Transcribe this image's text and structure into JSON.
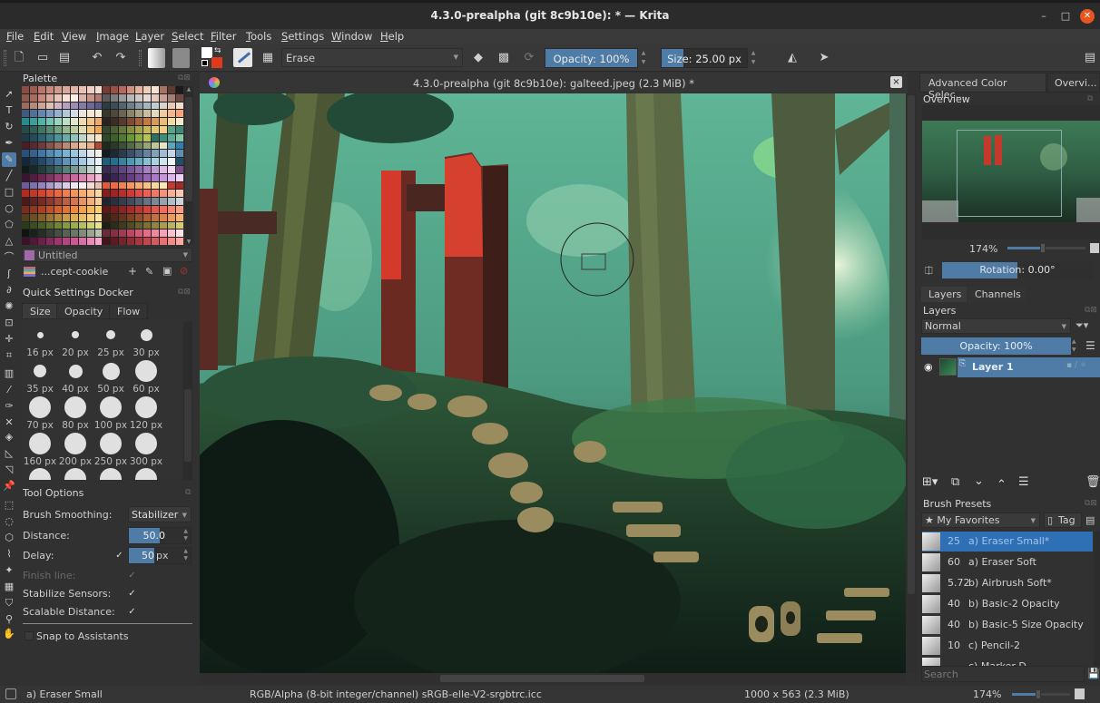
{
  "window": {
    "title": "4.3.0-prealpha (git 8c9b10e):  * — Krita",
    "minimize": "–",
    "maximize": "□",
    "close": "✕"
  },
  "menu": [
    "File",
    "Edit",
    "View",
    "Image",
    "Layer",
    "Select",
    "Filter",
    "Tools",
    "Settings",
    "Window",
    "Help"
  ],
  "toolbar": {
    "blend_mode": "Erase",
    "opacity_label": "Opacity: 100%",
    "opacity_value": 100,
    "size_label": "Size: 25.00 px",
    "size_fraction": 0.25,
    "fg_color": "#ffffff",
    "bg_color": "#e03a1e"
  },
  "document": {
    "tab_title": "4.3.0-prealpha (git 8c9b10e): galteed.jpeg (2.3 MiB) *",
    "close": "×"
  },
  "palette": {
    "title": "Palette",
    "swatch_name": "Untitled",
    "swatch_color": "#a06aa8",
    "palette_name": "...cept-cookie",
    "colors": [
      "#8a4d45",
      "#a05b4f",
      "#b8776a",
      "#c98a7c",
      "#d29a8c",
      "#dba79a",
      "#e3b3a6",
      "#eac1b4",
      "#f0cec2",
      "#f4ddd3",
      "#7a3b37",
      "#9c4f45",
      "#b7685a",
      "#d39080",
      "#e5b29e",
      "#f0cdb6",
      "#f6e2cf",
      "#a87462",
      "#5e3a32",
      "#1b1b1b",
      "#8d5a4e",
      "#a76c5e",
      "#c48b7d",
      "#d8a89a",
      "#e8c6b8",
      "#f5e1d6",
      "#fbeee6",
      "#d9b3a8",
      "#c5958a",
      "#b07a70",
      "#5c5a5a",
      "#7c7b7b",
      "#9b9a9a",
      "#b8b7b7",
      "#d1c8c4",
      "#e7d9d3",
      "#e9c8bd",
      "#c9a095",
      "#a47e75",
      "#6f4a44",
      "#9b6a5c",
      "#b7897a",
      "#cfa596",
      "#e1bfb1",
      "#d4b3c5",
      "#b8a0c0",
      "#9c8db5",
      "#857aa8",
      "#6e689a",
      "#5a598a",
      "#2d3b44",
      "#3d4d56",
      "#546570",
      "#6e808a",
      "#8b9ba5",
      "#a7b5be",
      "#c0cbd2",
      "#d8d2cc",
      "#ecc9b6",
      "#f2dccb",
      "#3e5b7e",
      "#50709a",
      "#6685b2",
      "#7d9ac4",
      "#98b0cf",
      "#b4c7db",
      "#d0dde8",
      "#e9e4dd",
      "#f3e6d4",
      "#f7ecd9",
      "#38372e",
      "#4d4a3b",
      "#6a6550",
      "#8a8468",
      "#a9a283",
      "#c7bf9f",
      "#e2dabb",
      "#f0c9a3",
      "#f4b58b",
      "#f7a27a",
      "#2b8a8a",
      "#3a9e9a",
      "#52b2a8",
      "#75c4b2",
      "#9ad3bc",
      "#bde0c5",
      "#dfe8cd",
      "#efd9ae",
      "#f2c38d",
      "#f0aa70",
      "#2a2320",
      "#3b2d26",
      "#56392f",
      "#7b4b38",
      "#a1613f",
      "#c27a47",
      "#d89a5b",
      "#e8bc7d",
      "#f2d9a4",
      "#f8ebc9",
      "#254a4a",
      "#2f5e58",
      "#3e7565",
      "#548c72",
      "#72a27f",
      "#95b78d",
      "#bccc9f",
      "#e2ddb0",
      "#f2c87e",
      "#f0a652",
      "#36482b",
      "#4c5f30",
      "#667637",
      "#858d3e",
      "#a6a34a",
      "#c7b75a",
      "#e0c771",
      "#efcf86",
      "#5aa58a",
      "#3f8a78",
      "#1d3a45",
      "#234c5a",
      "#2c6170",
      "#3a7a85",
      "#4e939a",
      "#6bacab",
      "#91c3ba",
      "#bcd6c7",
      "#e6e2cf",
      "#f6e7c6",
      "#2f4a2a",
      "#3d5f2e",
      "#507a31",
      "#6b9636",
      "#8cae42",
      "#b3c45a",
      "#2f6e62",
      "#3d8d7a",
      "#59ab91",
      "#83c7a8",
      "#4a1c23",
      "#5c2830",
      "#6f3a3d",
      "#88524d",
      "#a26c5e",
      "#c08a72",
      "#daa98a",
      "#ecc9a4",
      "#e8b08c",
      "#b0483a",
      "#1e2a1c",
      "#2b3a27",
      "#3c4e35",
      "#546747",
      "#72845e",
      "#97a47c",
      "#bfc59f",
      "#e4e4c6",
      "#5da5b8",
      "#2d7fb0",
      "#2a4f7a",
      "#34618f",
      "#3f76a5",
      "#4d8bb8",
      "#5f9fc7",
      "#78b3d3",
      "#98c6dc",
      "#bdd8e4",
      "#e1e9ea",
      "#f3efe6",
      "#141a22",
      "#1e2835",
      "#2a3a4c",
      "#3a5068",
      "#4e6985",
      "#6684a2",
      "#82a1bd",
      "#a2bdd3",
      "#c3d6e5",
      "#5f8fb0",
      "#13263a",
      "#1b3550",
      "#254869",
      "#335f85",
      "#4678a2",
      "#6093bc",
      "#80aed3",
      "#a6c8e5",
      "#cbe0f1",
      "#eaf1f8",
      "#1c5f7a",
      "#256f8c",
      "#37839e",
      "#4d99b1",
      "#67adc2",
      "#86c0d1",
      "#a8d2df",
      "#cbe4ec",
      "#ecf5f8",
      "#1f4e68",
      "#0e1a1c",
      "#162a2c",
      "#203c3d",
      "#2e5150",
      "#406865",
      "#58807b",
      "#769a93",
      "#98b4ac",
      "#bed0c8",
      "#e3ece6",
      "#3a2a52",
      "#4c3568",
      "#60437f",
      "#765497",
      "#8e68ad",
      "#a77fc2",
      "#c19ad5",
      "#dbb8e6",
      "#f3d8f4",
      "#7a4e8a",
      "#3b1530",
      "#521c3f",
      "#6a2650",
      "#833363",
      "#9c4276",
      "#b4548a",
      "#c9699e",
      "#dc82b2",
      "#eb9fc5",
      "#f6bfd9",
      "#2a1c3a",
      "#3a2550",
      "#4d3167",
      "#633f80",
      "#7b5099",
      "#9463b1",
      "#ae7ac7",
      "#c795da",
      "#dfb4ea",
      "#eed4f4",
      "#6a5c9a",
      "#7d6ead",
      "#9283be",
      "#a99bcd",
      "#c0b4db",
      "#d7cee8",
      "#ede8f4",
      "#f8f0f0",
      "#f4dcd6",
      "#ebc1b6",
      "#e05a3c",
      "#e86d48",
      "#ee8254",
      "#f29862",
      "#f5ae72",
      "#f7c385",
      "#f8d79b",
      "#f9e8b4",
      "#c43a2e",
      "#a22c25",
      "#b42a20",
      "#c73525",
      "#d6432c",
      "#e25434",
      "#eb673f",
      "#f17c4c",
      "#f5935c",
      "#f8aa6f",
      "#fac186",
      "#fbd8a0",
      "#8a1c1c",
      "#a12323",
      "#b92d2b",
      "#cf3a35",
      "#e04a42",
      "#ec5f52",
      "#f47765",
      "#f8917b",
      "#fbac94",
      "#fcc7b0",
      "#4a1a1a",
      "#5e2220",
      "#742c27",
      "#8c3a30",
      "#a44a3a",
      "#bc5e46",
      "#d27654",
      "#e49266",
      "#f0b07d",
      "#f8cd99",
      "#1e2530",
      "#28303d",
      "#333d4c",
      "#404c5d",
      "#50606f",
      "#637584",
      "#798b99",
      "#93a3af",
      "#aebdc6",
      "#cbd6dc",
      "#7a2c1e",
      "#923620",
      "#aa4222",
      "#c05025",
      "#d4602a",
      "#e47331",
      "#ef893b",
      "#f5a049",
      "#f8b95b",
      "#fad071",
      "#5e1616",
      "#761b1b",
      "#8e2222",
      "#a62b2a",
      "#bd3633",
      "#d3443e",
      "#e5564b",
      "#f26b5b",
      "#f8836e",
      "#fc9e85",
      "#55401e",
      "#6b5024",
      "#82622a",
      "#9a7532",
      "#b1893c",
      "#c79e48",
      "#daaf57",
      "#e9c06a",
      "#f4d183",
      "#fbe2a1",
      "#3a1e14",
      "#4e2818",
      "#64331d",
      "#7c4023",
      "#954e2a",
      "#ae5e33",
      "#c5703f",
      "#d9844d",
      "#e99a5f",
      "#f5b275",
      "#2c3a1c",
      "#3a4c22",
      "#4a5e28",
      "#5c712f",
      "#708438",
      "#869843",
      "#9dab51",
      "#b6be62",
      "#cfd077",
      "#e7e291",
      "#1e1e12",
      "#2c2c18",
      "#3c3b1e",
      "#4e4c25",
      "#625f2d",
      "#777236",
      "#8e8741",
      "#a69d4e",
      "#bdb35e",
      "#d6cb72",
      "#101410",
      "#1a201a",
      "#262e25",
      "#343e32",
      "#444f41",
      "#566252",
      "#6b7665",
      "#828c7b",
      "#9ca492",
      "#b9bfad",
      "#6a2a3a",
      "#852f45",
      "#a23a52",
      "#bd4762",
      "#d45875",
      "#e66d8a",
      "#f286a0",
      "#f9a2b6",
      "#fcc0cd",
      "#fde0e6",
      "#3c1228",
      "#521838",
      "#6a2048",
      "#832a5a",
      "#9c366d",
      "#b44580",
      "#c95893",
      "#db6fa5",
      "#ea8ab7",
      "#f5a8c9",
      "#45141a",
      "#5c1a22",
      "#74222b",
      "#8e2c35",
      "#a83840",
      "#c0474d",
      "#d55a5d",
      "#e67170",
      "#f38b86",
      "#fca8a0"
    ],
    "buttons": {
      "add": "+",
      "edit": "✎",
      "open": "▣",
      "delete": "⊘"
    }
  },
  "quick_settings": {
    "title": "Quick Settings Docker",
    "tabs": [
      "Size",
      "Opacity",
      "Flow"
    ],
    "active_tab": 0,
    "sizes": [
      "16 px",
      "20 px",
      "25 px",
      "30 px",
      "35 px",
      "40 px",
      "50 px",
      "60 px",
      "70 px",
      "80 px",
      "100 px",
      "120 px",
      "160 px",
      "200 px",
      "250 px",
      "300 px"
    ]
  },
  "tool_options": {
    "title": "Tool Options",
    "brush_smoothing_label": "Brush Smoothing:",
    "brush_smoothing_value": "Stabilizer",
    "distance_label": "Distance:",
    "distance_value": "50.0",
    "distance_fraction": 0.5,
    "delay_label": "Delay:",
    "delay_checked": true,
    "delay_value": "50",
    "delay_unit": "px",
    "finish_line_label": "Finish line:",
    "finish_line_checked": true,
    "stabilize_sensors_label": "Stabilize Sensors:",
    "stabilize_sensors_checked": true,
    "scalable_distance_label": "Scalable Distance:",
    "scalable_distance_checked": true,
    "snap_label": "Snap to Assistants",
    "snap_checked": false
  },
  "right_dock": {
    "tabs": [
      "Advanced Color Selec...",
      "Overvi..."
    ],
    "overview_title": "Overview",
    "zoom_label": "174%",
    "zoom_fraction": 0.45,
    "rotation_label": "Rotation: 0.00°",
    "rotation_fraction": 0.5,
    "layer_tabs": [
      "Layers",
      "Channels"
    ],
    "layers_title": "Layers",
    "blend_mode": "Normal",
    "opacity_label": "Opacity:  100%",
    "layers": [
      {
        "name": "Layer 1",
        "visible": true,
        "selected": true
      }
    ],
    "brush_presets_title": "Brush Presets",
    "preset_tag": "★ My Favorites",
    "tag_button": "Tag",
    "presets": [
      {
        "size": "25",
        "name": "a) Eraser Small*",
        "selected": true
      },
      {
        "size": "60",
        "name": "a) Eraser Soft",
        "selected": false
      },
      {
        "size": "5.72",
        "name": "b) Airbrush Soft*",
        "selected": false
      },
      {
        "size": "40",
        "name": "b) Basic-2 Opacity",
        "selected": false
      },
      {
        "size": "40",
        "name": "b) Basic-5 Size Opacity",
        "selected": false
      },
      {
        "size": "10",
        "name": "c) Pencil-2",
        "selected": false
      },
      {
        "size": "",
        "name": "c) Marker D...",
        "selected": false
      }
    ],
    "search_placeholder": "Search"
  },
  "statusbar": {
    "brush": "a) Eraser Small",
    "color_model": "RGB/Alpha (8-bit integer/channel)  sRGB-elle-V2-srgbtrc.icc",
    "dimensions": "1000 x 563 (2.3 MiB)",
    "zoom": "174%",
    "zoom_fraction": 0.45
  }
}
